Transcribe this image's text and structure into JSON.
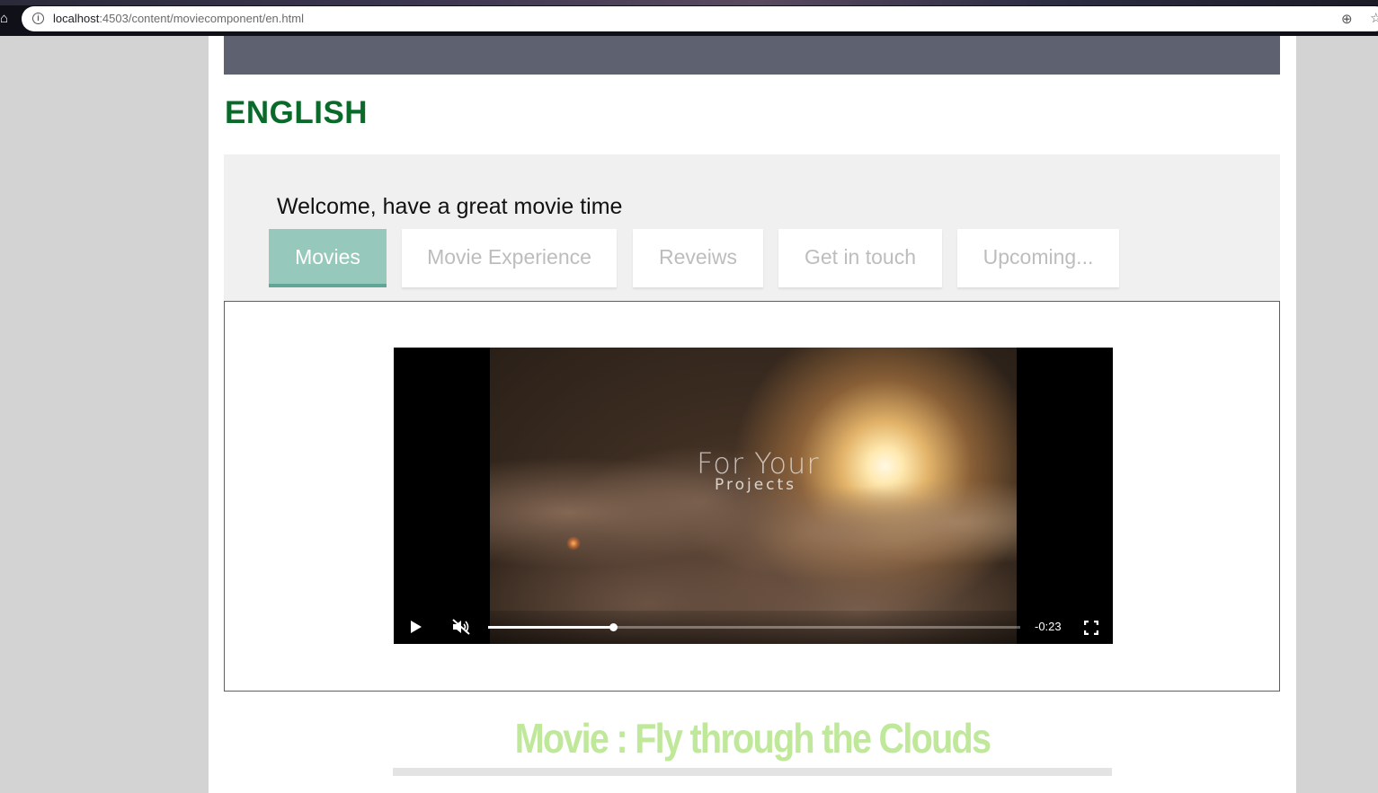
{
  "browser": {
    "url_host": "localhost",
    "url_path": ":4503/content/moviecomponent/en.html"
  },
  "page": {
    "title": "ENGLISH",
    "welcome": "Welcome, have a great movie time"
  },
  "tabs": [
    {
      "label": "Movies",
      "active": true
    },
    {
      "label": "Movie Experience",
      "active": false
    },
    {
      "label": "Reveiws",
      "active": false
    },
    {
      "label": "Get in touch",
      "active": false
    },
    {
      "label": "Upcoming...",
      "active": false
    }
  ],
  "video": {
    "caption_line1": "For Your",
    "caption_line2": "Projects",
    "time_remaining": "-0:23",
    "progress_fraction": 0.235,
    "muted": true
  },
  "movie": {
    "title": "Movie : Fly through the Clouds"
  },
  "colors": {
    "heading_green": "#0a6a2a",
    "active_tab": "#96c9bc",
    "movie_title": "#c0e89a"
  },
  "icons": {
    "home": "home-icon",
    "info": "info-icon",
    "zoom": "zoom-icon",
    "bookmark": "star-icon",
    "play": "play-icon",
    "mute": "mute-icon",
    "fullscreen": "fullscreen-icon"
  }
}
